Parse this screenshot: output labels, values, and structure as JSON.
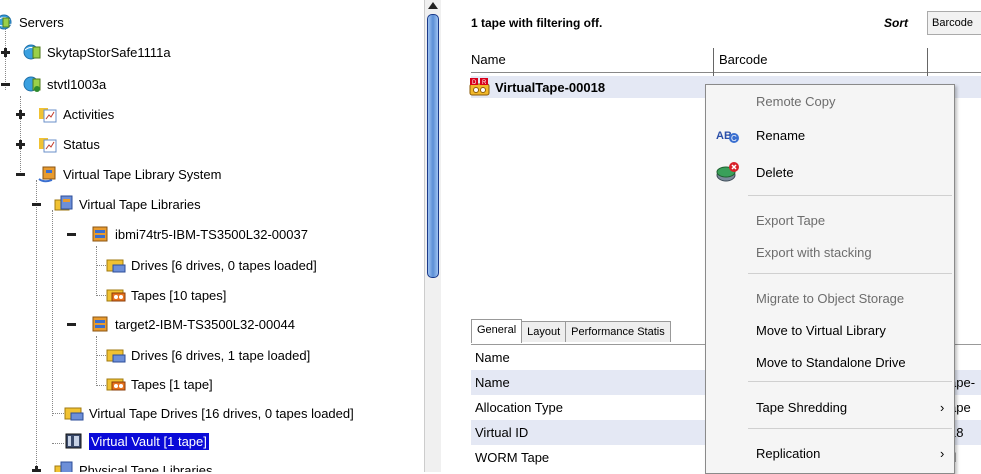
{
  "tree": {
    "items": [
      {
        "label": "Servers",
        "icon": "servers-globe-icon"
      },
      {
        "label": "SkytapStorSafe1111a",
        "icon": "server-globe-icon"
      },
      {
        "label": "stvtl1003a",
        "icon": "server-globe-connected-icon"
      },
      {
        "label": "Activities",
        "icon": "activity-chart-icon"
      },
      {
        "label": "Status",
        "icon": "status-chart-icon"
      },
      {
        "label": "Virtual Tape Library System",
        "icon": "tape-library-system-icon"
      },
      {
        "label": "Virtual Tape Libraries",
        "icon": "tape-libraries-folder-icon"
      },
      {
        "label": "ibmi74tr5-IBM-TS3500L32-00037",
        "icon": "tape-library-icon"
      },
      {
        "label": "Drives [6 drives, 0 tapes loaded]",
        "icon": "drives-folder-icon"
      },
      {
        "label": "Tapes [10 tapes]",
        "icon": "tapes-folder-icon"
      },
      {
        "label": "target2-IBM-TS3500L32-00044",
        "icon": "tape-library-icon"
      },
      {
        "label": "Drives [6 drives, 1 tape loaded]",
        "icon": "drives-folder-icon"
      },
      {
        "label": "Tapes [1 tape]",
        "icon": "tapes-folder-icon"
      },
      {
        "label": "Virtual Tape Drives [16 drives, 0 tapes loaded]",
        "icon": "drives-folder-icon"
      },
      {
        "label": "Virtual Vault [1 tape]",
        "icon": "vault-icon",
        "selected": true
      },
      {
        "label": "Physical Tape Libraries",
        "icon": "tape-libraries-folder-icon"
      }
    ]
  },
  "list": {
    "summary": "1 tape with filtering off.",
    "sort_label": "Sort",
    "sort_value": "Barcode",
    "columns": [
      "Name",
      "Barcode"
    ],
    "rows": [
      {
        "name": "VirtualTape-00018",
        "badge": "D R"
      }
    ]
  },
  "tabs": [
    "General",
    "Layout",
    "Performance Statis"
  ],
  "properties": {
    "header": "Name",
    "rows": [
      {
        "name": "Name",
        "value": "ape-"
      },
      {
        "name": "Allocation Type",
        "value": "ape"
      },
      {
        "name": "Virtual ID",
        "value": "18"
      },
      {
        "name": "WORM Tape",
        "value": "d"
      }
    ]
  },
  "context_menu": {
    "items": [
      {
        "label": "Remote Copy",
        "disabled": true
      },
      {
        "label": "Rename",
        "icon": "rename-abc-icon"
      },
      {
        "label": "Delete",
        "icon": "delete-icon"
      },
      {
        "label": "Export Tape",
        "disabled": true
      },
      {
        "label": "Export with stacking",
        "disabled": true
      },
      {
        "label": "Migrate to Object Storage",
        "disabled": true
      },
      {
        "label": "Move to Virtual Library"
      },
      {
        "label": "Move to Standalone Drive"
      },
      {
        "label": "Tape Shredding",
        "submenu": true
      },
      {
        "label": "Replication",
        "submenu": true
      }
    ],
    "submenu_glyph": "›"
  },
  "colors": {
    "selection": "#0a0ad8",
    "row_highlight": "#e4e8f4",
    "menu_bg": "#f5f5f5",
    "disabled_text": "#6d6d6d"
  }
}
